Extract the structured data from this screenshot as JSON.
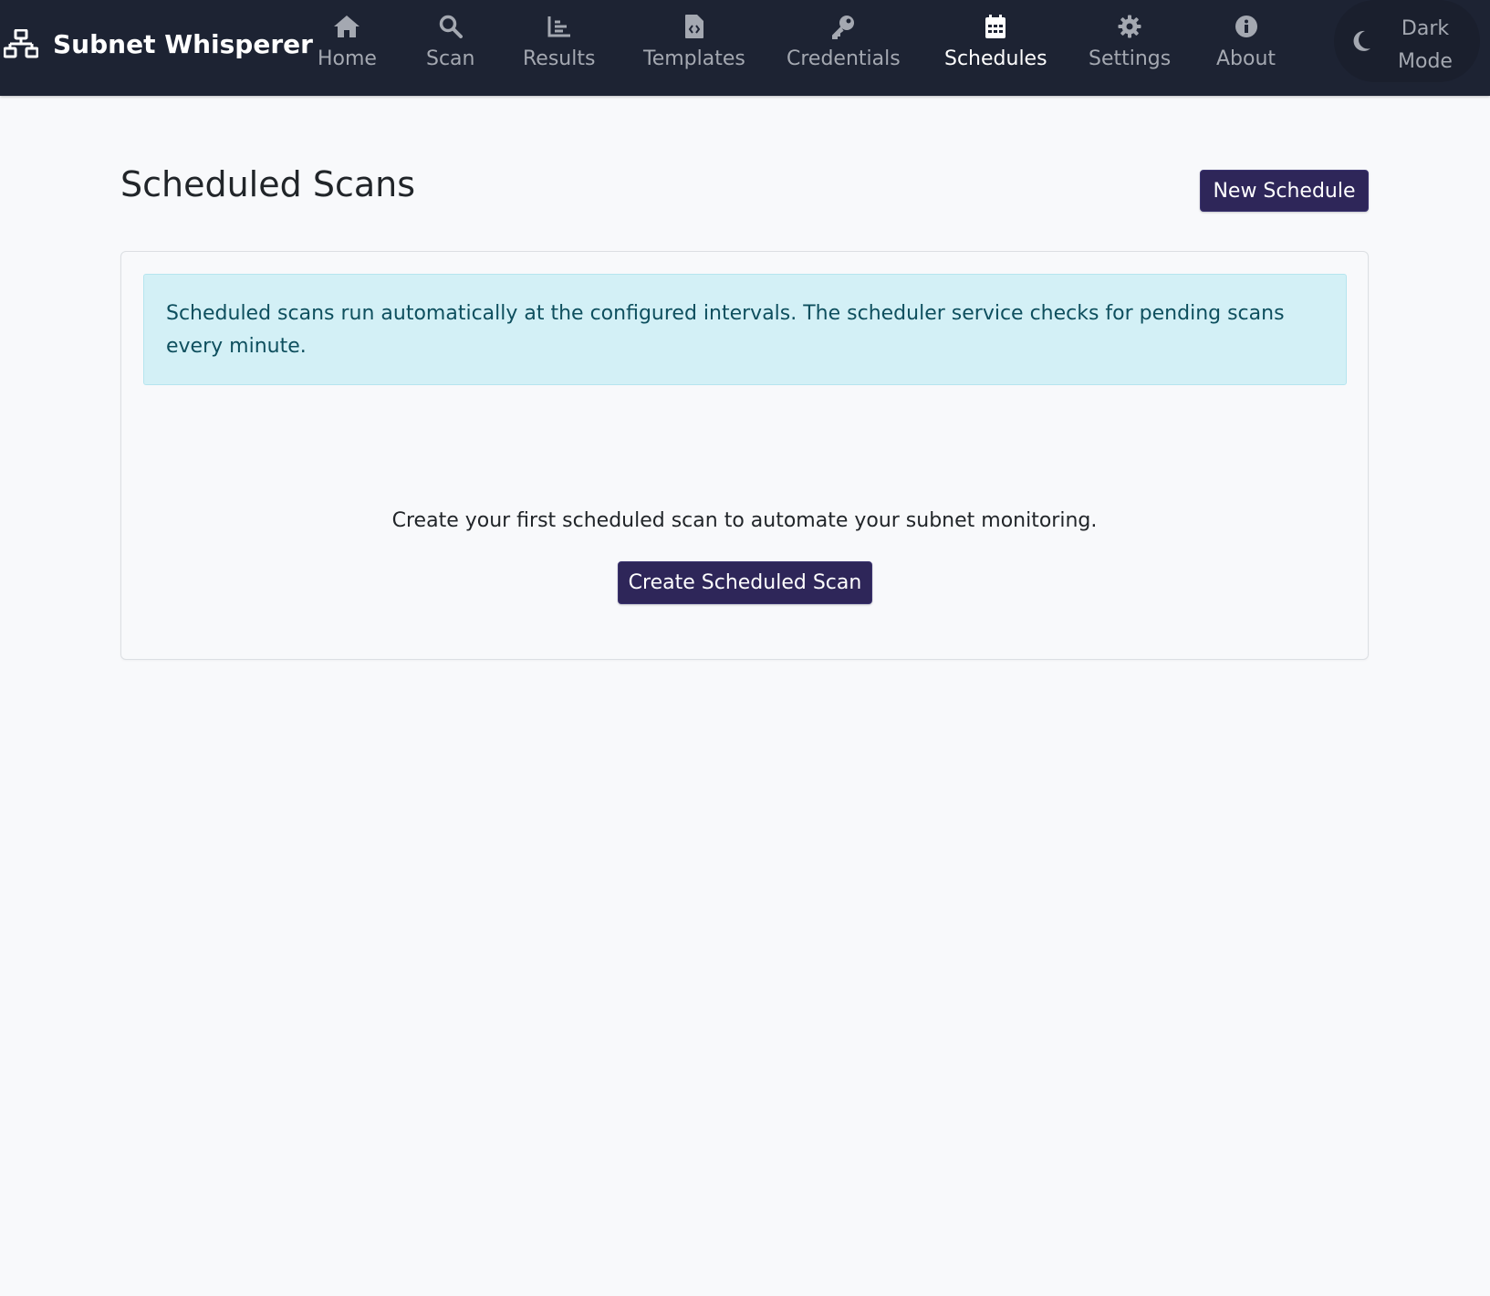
{
  "app": {
    "brand": "Subnet Whisperer",
    "brand_icon": "network-icon"
  },
  "nav": {
    "items": [
      {
        "label": "Home",
        "icon": "home-icon",
        "active": false
      },
      {
        "label": "Scan",
        "icon": "search-icon",
        "active": false
      },
      {
        "label": "Results",
        "icon": "chart-icon",
        "active": false
      },
      {
        "label": "Templates",
        "icon": "file-code-icon",
        "active": false
      },
      {
        "label": "Credentials",
        "icon": "key-icon",
        "active": false
      },
      {
        "label": "Schedules",
        "icon": "calendar-icon",
        "active": true
      },
      {
        "label": "Settings",
        "icon": "gear-icon",
        "active": false
      },
      {
        "label": "About",
        "icon": "info-icon",
        "active": false
      }
    ],
    "theme_toggle": {
      "line1": "Dark",
      "line2": "Mode",
      "icon": "moon-icon"
    }
  },
  "page": {
    "title": "Scheduled Scans",
    "new_button": "New Schedule"
  },
  "card": {
    "info_text": "Scheduled scans run automatically at the configured intervals. The scheduler service checks for pending scans every minute.",
    "empty_text": "Create your first scheduled scan to automate your subnet monitoring.",
    "create_button": "Create Scheduled Scan"
  },
  "colors": {
    "navbar_bg": "#1d2333",
    "primary": "#2e2659",
    "info_bg": "#d3f0f6",
    "info_text": "#0e4f5e",
    "page_bg": "#f8f9fb"
  }
}
